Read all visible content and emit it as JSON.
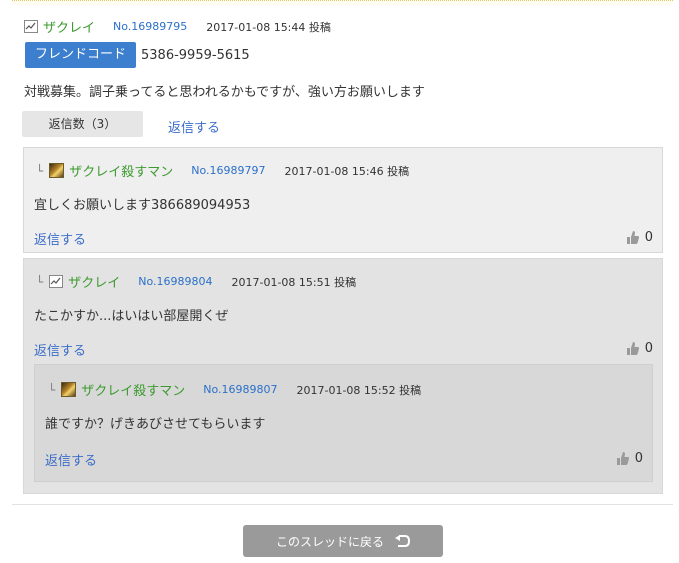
{
  "post": {
    "username": "ザクレイ",
    "number": "No.16989795",
    "date": "2017-01-08 15:44 投稿",
    "friend_code_label": "フレンドコード",
    "friend_code": "5386-9959-5615",
    "body": "対戦募集。調子乗ってると思われるかもですが、強い方お願いします",
    "reply_count": "返信数（3）",
    "reply_link": "返信する"
  },
  "replies": [
    {
      "branch": "└",
      "username": "ザクレイ殺すマン",
      "number": "No.16989797",
      "date": "2017-01-08 15:46 投稿",
      "body": "宜しくお願いします386689094953",
      "reply_link": "返信する",
      "likes": "0",
      "icon": "avatar-icon"
    },
    {
      "branch": "└",
      "username": "ザクレイ",
      "number": "No.16989804",
      "date": "2017-01-08 15:51 投稿",
      "body": "たこかすか...はいはい部屋開くぜ",
      "reply_link": "返信する",
      "likes": "0",
      "icon": "game-icon"
    },
    {
      "branch": "└",
      "username": "ザクレイ殺すマン",
      "number": "No.16989807",
      "date": "2017-01-08 15:52 投稿",
      "body": "誰ですか？げきあびさせてもらいます",
      "reply_link": "返信する",
      "likes": "0",
      "icon": "avatar-icon"
    }
  ],
  "footer": {
    "back_label": "このスレッドに戻る"
  },
  "colors": {
    "username": "#3c9a2e",
    "postno": "#2b70c9",
    "link": "#3a6cc9",
    "badge": "#3d7fcf",
    "back_button": "#9a9a9a"
  }
}
